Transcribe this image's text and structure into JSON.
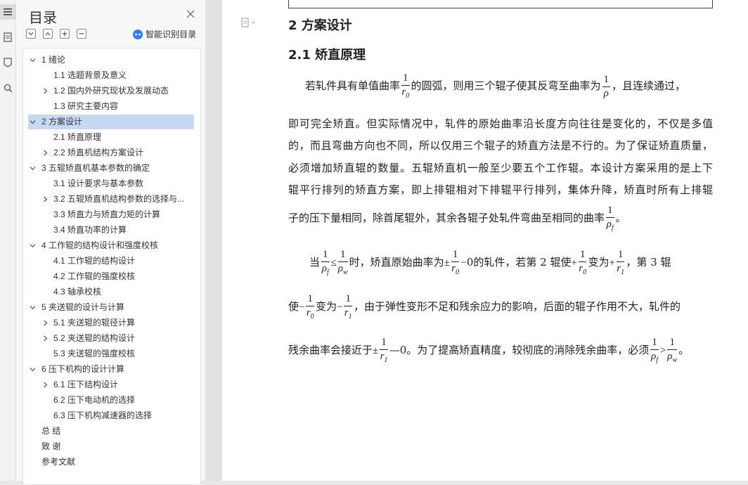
{
  "rail": {
    "icons": [
      "menu-icon",
      "document-icon",
      "tag-icon",
      "search-icon"
    ]
  },
  "panel": {
    "title": "目录",
    "smart_label": "智能识别目录",
    "items": [
      {
        "label": "1  绪论",
        "level": 1,
        "expand": "open"
      },
      {
        "label": "1.1  选题背景及意义",
        "level": 2,
        "expand": "none"
      },
      {
        "label": "1.2  国内外研究现状及发展动态",
        "level": 2,
        "expand": "closed"
      },
      {
        "label": "1.3  研究主要内容",
        "level": 2,
        "expand": "none"
      },
      {
        "label": "2  方案设计",
        "level": 1,
        "expand": "open",
        "selected": true
      },
      {
        "label": "2.1  矫直原理",
        "level": 2,
        "expand": "none"
      },
      {
        "label": "2.2  矫直机结构方案设计",
        "level": 2,
        "expand": "closed"
      },
      {
        "label": "3  五辊矫直机基本参数的确定",
        "level": 1,
        "expand": "open"
      },
      {
        "label": "3.1  设计要求与基本参数",
        "level": 2,
        "expand": "none"
      },
      {
        "label": "3.2  五辊矫直机结构参数的选择与...",
        "level": 2,
        "expand": "closed"
      },
      {
        "label": "3.3 矫直力与矫直力矩的计算",
        "level": 2,
        "expand": "none"
      },
      {
        "label": "3.4  矫直功率的计算",
        "level": 2,
        "expand": "none"
      },
      {
        "label": "4  工作辊的结构设计和强度校核",
        "level": 1,
        "expand": "open"
      },
      {
        "label": "4.1 工作辊的结构设计",
        "level": 2,
        "expand": "none"
      },
      {
        "label": "4.2 工作辊的强度校核",
        "level": 2,
        "expand": "none"
      },
      {
        "label": "4.3 轴承校核",
        "level": 2,
        "expand": "none"
      },
      {
        "label": "5  夹送辊的设计与计算",
        "level": 1,
        "expand": "open"
      },
      {
        "label": "5.1  夹送辊的辊径计算",
        "level": 2,
        "expand": "closed"
      },
      {
        "label": "5.2  夹送辊的结构设计",
        "level": 2,
        "expand": "closed"
      },
      {
        "label": "5.3  夹送辊的强度校核",
        "level": 2,
        "expand": "none"
      },
      {
        "label": "6  压下机构的设计计算",
        "level": 1,
        "expand": "open"
      },
      {
        "label": "6.1 压下结构设计",
        "level": 2,
        "expand": "closed"
      },
      {
        "label": "6.2 压下电动机的选择",
        "level": 2,
        "expand": "none"
      },
      {
        "label": "6.3 压下机构减速器的选择",
        "level": 2,
        "expand": "none"
      },
      {
        "label": "总    结",
        "level": 0,
        "expand": "none"
      },
      {
        "label": "致    谢",
        "level": 0,
        "expand": "none"
      },
      {
        "label": "参考文献",
        "level": 0,
        "expand": "none"
      }
    ]
  },
  "doc": {
    "h2": "2  方案设计",
    "h3": "2.1  矫直原理",
    "p1": {
      "a": "若轧件具有单值曲率",
      "b": "的圆弧，则用三个辊子使其反弯至曲率为",
      "c": "，且连续通过，"
    },
    "p1_lines": [
      "即可完全矫直。但实际情况中，轧件的原始曲率沿长度方向往往是变化的，不仅是多值",
      "的，而且弯曲方向也不同，所以仅用三个辊子的矫直方法是不行的。为了保证矫直质量，",
      "必须增加矫直辊的数量。五辊矫直机一般至少要五个工作辊。本设计方案采用的是上下",
      "辊平行排列的矫直方案，即上排辊相对下排辊平行排列，集体升降，矫直时所有上排辊"
    ],
    "p1_last": "子的压下量相同，除首尾辊外，其余各辊子处轧件弯曲至相同的曲率",
    "p2": {
      "a": "当",
      "b": "时，矫直原始曲率为",
      "c": "0的轧件，若第 2 辊使",
      "d": "变为",
      "e": "，第 3 辊",
      "f": "使",
      "g": "变为",
      "h": "，由于弹性变形不足和残余应力的影响，后面的辊子作用不大，轧件的",
      "i": "残余曲率会接近于",
      "j": "—0。为了提高矫直精度，较彻底的消除残余曲率，必须",
      "k": "。"
    },
    "math": {
      "one": "1",
      "r": "r",
      "rho": "ρ",
      "sub0": "0",
      "sub1": "1",
      "subf": "f",
      "subw": "w",
      "le": "≤",
      "gt": ">",
      "pm": "±",
      "plus": "+",
      "minus": "−",
      "dash": "—",
      "period": "。"
    }
  },
  "colors": {
    "selected": "#c7d8f3",
    "accent": "#2f7ef2"
  }
}
